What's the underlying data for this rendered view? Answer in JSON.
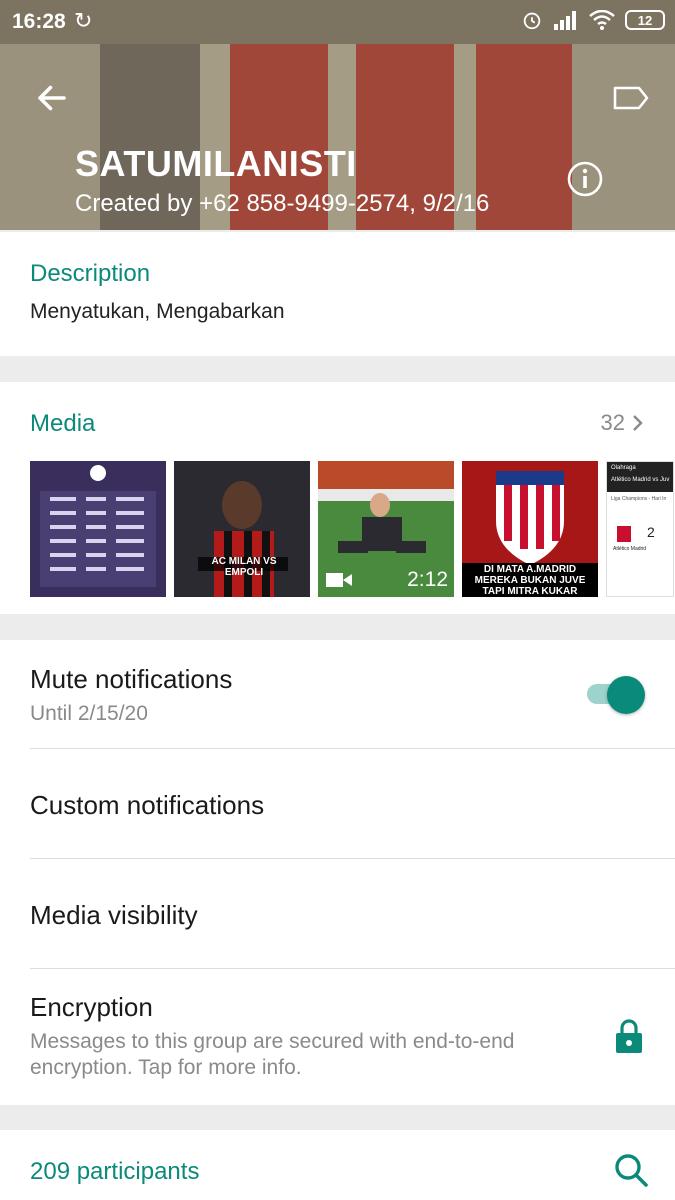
{
  "status_bar": {
    "time": "16:28",
    "battery": "12",
    "icons": [
      "sync-icon",
      "alarm-icon",
      "signal-icon",
      "wifi-icon",
      "battery-icon"
    ]
  },
  "header": {
    "title": "SATUMILANISTI",
    "subtitle": "Created by +62 858-9499-2574, 9/2/16",
    "icons": [
      "back-arrow-icon",
      "label-icon",
      "info-icon"
    ]
  },
  "description": {
    "title": "Description",
    "text": "Menyatukan, Mengabarkan"
  },
  "media": {
    "title": "Media",
    "count": "32",
    "thumbnails": [
      {
        "name": "thumbnail-standings"
      },
      {
        "name": "thumbnail-ac-milan-vs-empoli",
        "caption": "AC MILAN VS EMPOLI"
      },
      {
        "name": "thumbnail-video",
        "duration": "2:12"
      },
      {
        "name": "thumbnail-atletico-madrid",
        "caption_line1": "DI MATA A.MADRID",
        "caption_line2": "MEREKA BUKAN JUVE",
        "caption_line3": "TAPI MITRA KUKAR"
      },
      {
        "name": "thumbnail-match-card",
        "caption": "Olahraga",
        "subcaption": "Atlético Madrid vs Juv",
        "league": "Liga Champions - Hari In",
        "score": "2",
        "team": "Atlético Madrid"
      }
    ]
  },
  "settings": {
    "mute": {
      "title": "Mute notifications",
      "subtitle": "Until 2/15/20",
      "enabled": true
    },
    "custom": {
      "title": "Custom notifications"
    },
    "visibility": {
      "title": "Media visibility"
    },
    "encryption": {
      "title": "Encryption",
      "subtitle": "Messages to this group are secured with end-to-end encryption. Tap for more info."
    }
  },
  "participants": {
    "title": "209 participants"
  },
  "colors": {
    "accent": "#0b8a7a",
    "toggle_track": "#9ed3cc"
  }
}
